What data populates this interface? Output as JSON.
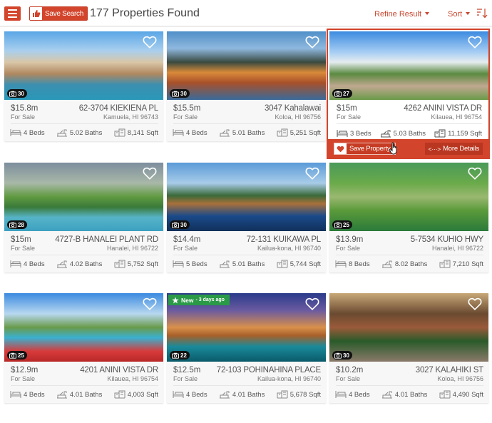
{
  "header": {
    "menu_icon": "hamburger-icon",
    "save_search_label": "Save Search",
    "save_search_icon": "thumbs-up-icon",
    "results_count_text": "177 Properties Found",
    "refine_label": "Refine Result",
    "sort_label": "Sort",
    "sort_direction_icon": "sort-descending-icon"
  },
  "colors": {
    "accent": "#d2442b",
    "new_badge": "#2a9a47",
    "text": "#555555"
  },
  "listings": [
    {
      "price": "$15.8m",
      "status": "For Sale",
      "address": "62-3704 KIEKIENA PL",
      "city": "Kamuela, HI 96743",
      "photos": "30",
      "beds": "4 Beds",
      "baths": "5.02 Baths",
      "sqft": "8,141 Sqft"
    },
    {
      "price": "$15.5m",
      "status": "For Sale",
      "address": "3047 Kahalawai",
      "city": "Koloa, HI 96756",
      "photos": "30",
      "beds": "4 Beds",
      "baths": "5.01 Baths",
      "sqft": "5,251 Sqft"
    },
    {
      "price": "$15m",
      "status": "For Sale",
      "address": "4262 ANINI VISTA DR",
      "city": "Kilauea, HI 96754",
      "photos": "27",
      "beds": "3 Beds",
      "baths": "5.03 Baths",
      "sqft": "11,159 Sqft",
      "save_label": "Save Property",
      "details_label": "More Details",
      "details_icon": "<···>"
    },
    {
      "price": "$15m",
      "status": "For Sale",
      "address": "4727-B HANALEI PLANT RD",
      "city": "Hanalei, HI 96722",
      "photos": "28",
      "beds": "4 Beds",
      "baths": "4.02 Baths",
      "sqft": "5,752 Sqft"
    },
    {
      "price": "$14.4m",
      "status": "For Sale",
      "address": "72-131 KUIKAWA PL",
      "city": "Kailua-kona, HI 96740",
      "photos": "30",
      "beds": "5 Beds",
      "baths": "5.01 Baths",
      "sqft": "5,744 Sqft"
    },
    {
      "price": "$13.9m",
      "status": "For Sale",
      "address": "5-7534 KUHIO HWY",
      "city": "Hanalei, HI 96722",
      "photos": "25",
      "beds": "8 Beds",
      "baths": "8.02 Baths",
      "sqft": "7,210 Sqft"
    },
    {
      "price": "$12.9m",
      "status": "For Sale",
      "address": "4201 ANINI VISTA DR",
      "city": "Kilauea, HI 96754",
      "photos": "25",
      "beds": "4 Beds",
      "baths": "4.01 Baths",
      "sqft": "4,003 Sqft"
    },
    {
      "price": "$12.5m",
      "status": "For Sale",
      "address": "72-103 POHINAHINA PLACE",
      "city": "Kailua-kona, HI 96740",
      "photos": "22",
      "beds": "4 Beds",
      "baths": "4.01 Baths",
      "sqft": "5,678 Sqft",
      "badge_new": "New",
      "badge_age": " - 3 days ago"
    },
    {
      "price": "$10.2m",
      "status": "For Sale",
      "address": "3027 KALAHIKI ST",
      "city": "Koloa, HI 96756",
      "photos": "30",
      "beds": "4 Beds",
      "baths": "4.01 Baths",
      "sqft": "4,490 Sqft"
    }
  ]
}
